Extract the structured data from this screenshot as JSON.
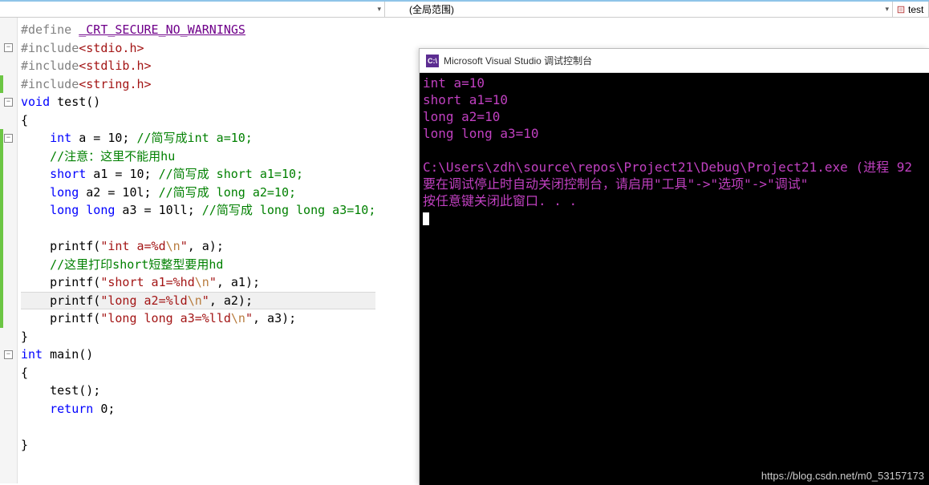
{
  "topbar": {
    "scope_label": "(全局范围)",
    "right_label": "test"
  },
  "code_lines": [
    {
      "fold": null,
      "cb": null,
      "tokens": [
        {
          "c": "pp",
          "t": "#define "
        },
        {
          "c": "mac",
          "t": "_CRT_SECURE_NO_WARNINGS"
        }
      ]
    },
    {
      "fold": "-",
      "cb": null,
      "tokens": [
        {
          "c": "pp",
          "t": "#include"
        },
        {
          "c": "inc",
          "t": "<stdio.h>"
        }
      ]
    },
    {
      "fold": null,
      "cb": null,
      "tokens": [
        {
          "c": "pp",
          "t": "#include"
        },
        {
          "c": "inc",
          "t": "<stdlib.h>"
        }
      ]
    },
    {
      "fold": null,
      "cb": "green",
      "tokens": [
        {
          "c": "pp",
          "t": "#include"
        },
        {
          "c": "inc",
          "t": "<string.h>"
        }
      ]
    },
    {
      "fold": "-",
      "cb": null,
      "tokens": [
        {
          "c": "kw",
          "t": "void"
        },
        {
          "c": "txt",
          "t": " test()"
        }
      ]
    },
    {
      "fold": null,
      "cb": null,
      "tokens": [
        {
          "c": "txt",
          "t": "{"
        }
      ]
    },
    {
      "fold": "-",
      "cb": "green",
      "tokens": [
        {
          "c": "txt",
          "t": "    "
        },
        {
          "c": "kw",
          "t": "int"
        },
        {
          "c": "txt",
          "t": " a = 10; "
        },
        {
          "c": "cmt",
          "t": "//简写成int a=10;"
        }
      ]
    },
    {
      "fold": null,
      "cb": "green",
      "tokens": [
        {
          "c": "txt",
          "t": "    "
        },
        {
          "c": "cmt",
          "t": "//注意：这里不能用hu"
        }
      ]
    },
    {
      "fold": null,
      "cb": "green",
      "tokens": [
        {
          "c": "txt",
          "t": "    "
        },
        {
          "c": "kw",
          "t": "short"
        },
        {
          "c": "txt",
          "t": " a1 = 10; "
        },
        {
          "c": "cmt",
          "t": "//简写成 short a1=10;"
        }
      ]
    },
    {
      "fold": null,
      "cb": "green",
      "tokens": [
        {
          "c": "txt",
          "t": "    "
        },
        {
          "c": "kw",
          "t": "long"
        },
        {
          "c": "txt",
          "t": " a2 = 10l; "
        },
        {
          "c": "cmt",
          "t": "//简写成 long a2=10;"
        }
      ]
    },
    {
      "fold": null,
      "cb": "green",
      "tokens": [
        {
          "c": "txt",
          "t": "    "
        },
        {
          "c": "kw",
          "t": "long long"
        },
        {
          "c": "txt",
          "t": " a3 = 10ll; "
        },
        {
          "c": "cmt",
          "t": "//简写成 long long a3=10;"
        }
      ]
    },
    {
      "fold": null,
      "cb": "green",
      "tokens": []
    },
    {
      "fold": null,
      "cb": "green",
      "tokens": [
        {
          "c": "txt",
          "t": "    printf("
        },
        {
          "c": "str",
          "t": "\"int a=%d"
        },
        {
          "c": "esc",
          "t": "\\n"
        },
        {
          "c": "str",
          "t": "\""
        },
        {
          "c": "txt",
          "t": ", a);"
        }
      ]
    },
    {
      "fold": null,
      "cb": "green",
      "tokens": [
        {
          "c": "txt",
          "t": "    "
        },
        {
          "c": "cmt",
          "t": "//这里打印short短整型要用hd"
        }
      ]
    },
    {
      "fold": null,
      "cb": "green",
      "tokens": [
        {
          "c": "txt",
          "t": "    printf("
        },
        {
          "c": "str",
          "t": "\"short a1=%hd"
        },
        {
          "c": "esc",
          "t": "\\n"
        },
        {
          "c": "str",
          "t": "\""
        },
        {
          "c": "txt",
          "t": ", a1);"
        }
      ]
    },
    {
      "fold": null,
      "cb": "green",
      "hl": true,
      "tokens": [
        {
          "c": "txt",
          "t": "    printf("
        },
        {
          "c": "str",
          "t": "\"long a2=%ld"
        },
        {
          "c": "esc",
          "t": "\\n"
        },
        {
          "c": "str",
          "t": "\""
        },
        {
          "c": "txt",
          "t": ", a2);"
        }
      ]
    },
    {
      "fold": null,
      "cb": "green",
      "tokens": [
        {
          "c": "txt",
          "t": "    printf("
        },
        {
          "c": "str",
          "t": "\"long long a3=%lld"
        },
        {
          "c": "esc",
          "t": "\\n"
        },
        {
          "c": "str",
          "t": "\""
        },
        {
          "c": "txt",
          "t": ", a3);"
        }
      ]
    },
    {
      "fold": null,
      "cb": null,
      "tokens": [
        {
          "c": "txt",
          "t": "}"
        }
      ]
    },
    {
      "fold": "-",
      "cb": null,
      "tokens": [
        {
          "c": "kw",
          "t": "int"
        },
        {
          "c": "txt",
          "t": " main()"
        }
      ]
    },
    {
      "fold": null,
      "cb": null,
      "tokens": [
        {
          "c": "txt",
          "t": "{"
        }
      ]
    },
    {
      "fold": null,
      "cb": null,
      "tokens": [
        {
          "c": "txt",
          "t": "    test();"
        }
      ]
    },
    {
      "fold": null,
      "cb": null,
      "tokens": [
        {
          "c": "txt",
          "t": "    "
        },
        {
          "c": "kw",
          "t": "return"
        },
        {
          "c": "txt",
          "t": " 0;"
        }
      ]
    },
    {
      "fold": null,
      "cb": null,
      "tokens": []
    },
    {
      "fold": null,
      "cb": null,
      "tokens": [
        {
          "c": "txt",
          "t": "}"
        }
      ]
    }
  ],
  "console": {
    "title": "Microsoft Visual Studio 调试控制台",
    "icon_text": "C:\\",
    "lines": [
      "int a=10",
      "short a1=10",
      "long a2=10",
      "long long a3=10",
      "",
      "C:\\Users\\zdh\\source\\repos\\Project21\\Debug\\Project21.exe (进程 92",
      "要在调试停止时自动关闭控制台，请启用\"工具\"->\"选项\"->\"调试\"",
      "按任意键关闭此窗口. . ."
    ]
  },
  "watermark": "https://blog.csdn.net/m0_53157173"
}
